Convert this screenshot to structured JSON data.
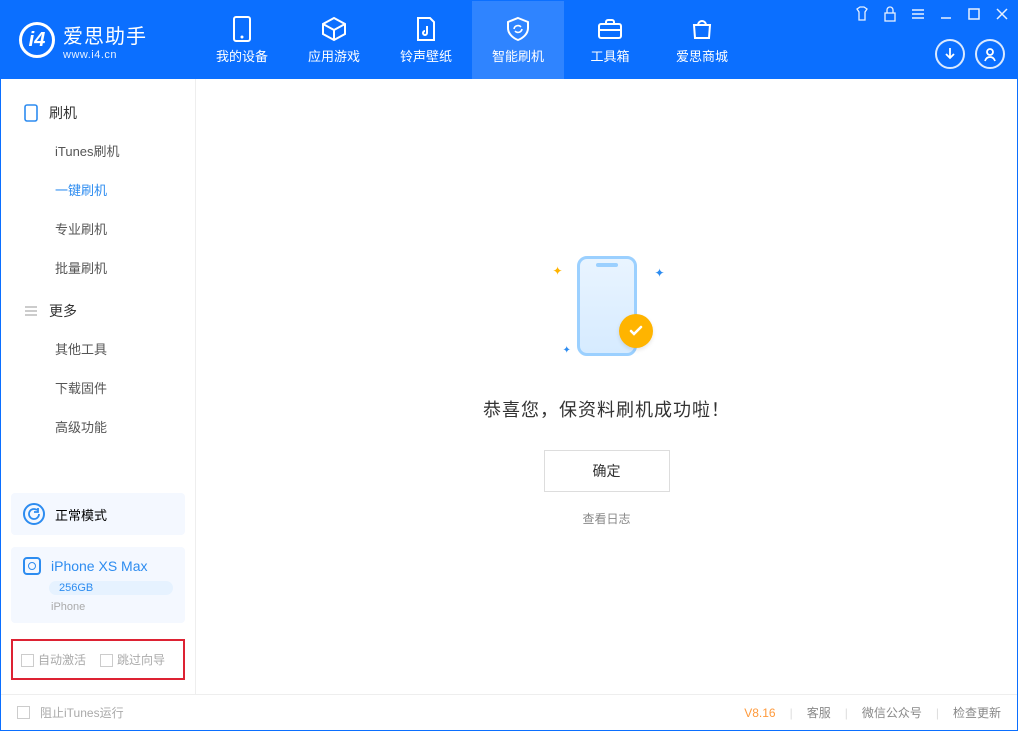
{
  "app": {
    "name": "爱思助手",
    "site": "www.i4.cn"
  },
  "nav": {
    "items": [
      {
        "label": "我的设备"
      },
      {
        "label": "应用游戏"
      },
      {
        "label": "铃声壁纸"
      },
      {
        "label": "智能刷机"
      },
      {
        "label": "工具箱"
      },
      {
        "label": "爱思商城"
      }
    ],
    "active_index": 3
  },
  "sidebar": {
    "section1": {
      "title": "刷机",
      "items": [
        "iTunes刷机",
        "一键刷机",
        "专业刷机",
        "批量刷机"
      ],
      "active_index": 1
    },
    "section2": {
      "title": "更多",
      "items": [
        "其他工具",
        "下载固件",
        "高级功能"
      ]
    },
    "status": {
      "label": "正常模式"
    },
    "device": {
      "name": "iPhone XS Max",
      "capacity": "256GB",
      "type": "iPhone"
    },
    "options": {
      "opt1": "自动激活",
      "opt2": "跳过向导"
    }
  },
  "main": {
    "message": "恭喜您，保资料刷机成功啦！",
    "ok": "确定",
    "log_link": "查看日志"
  },
  "footer": {
    "block_itunes": "阻止iTunes运行",
    "version": "V8.16",
    "links": [
      "客服",
      "微信公众号",
      "检查更新"
    ]
  }
}
